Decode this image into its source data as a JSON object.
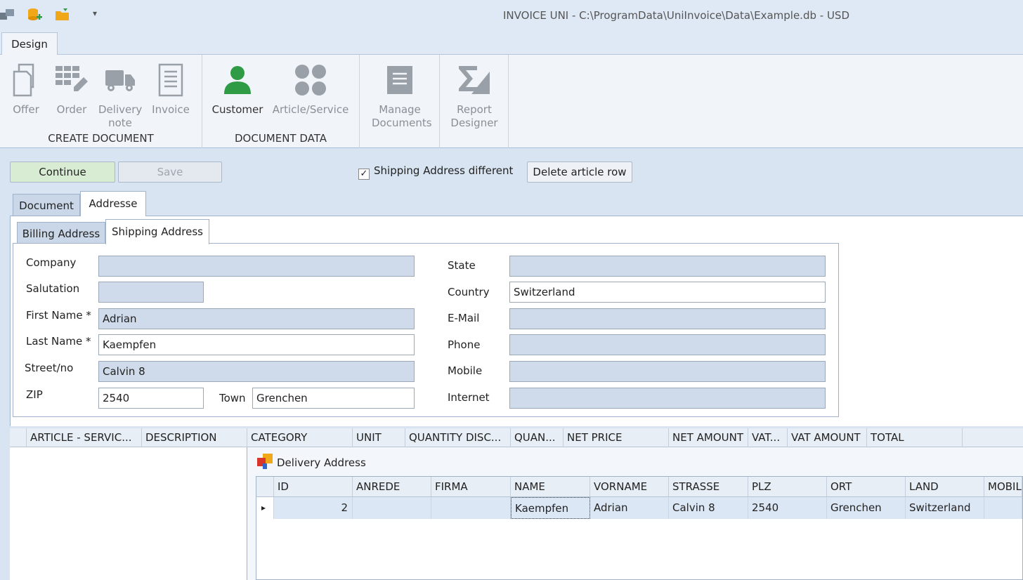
{
  "window": {
    "title": "INVOICE UNI - C:\\ProgramData\\UniInvoice\\Data\\Example.db - USD"
  },
  "quick_access": {
    "icons": [
      "app-icon",
      "database-add-icon",
      "folder-open-icon",
      "customize-dropdown-icon"
    ],
    "dropdown_glyph": "▾"
  },
  "ribbon": {
    "tab": "Design",
    "groups": {
      "create_document": {
        "label": "CREATE DOCUMENT",
        "offer": "Offer",
        "order": "Order",
        "delivery_note": "Delivery note",
        "invoice": "Invoice"
      },
      "document_data": {
        "label": "DOCUMENT DATA",
        "customer": "Customer",
        "article_service": "Article/Service"
      },
      "manage": {
        "label": "Manage Documents"
      },
      "report": {
        "label": "Report Designer"
      }
    },
    "accent_green": "#2f9b45"
  },
  "toolbar": {
    "continue": "Continue",
    "save": "Save",
    "shipping_different": "Shipping Address different",
    "shipping_checked": "✓",
    "delete_row": "Delete article row"
  },
  "tabs": {
    "document": "Document",
    "addresse": "Addresse",
    "billing": "Billing Address",
    "shipping": "Shipping Address"
  },
  "form": {
    "company": {
      "label": "Company",
      "value": ""
    },
    "salutation": {
      "label": "Salutation",
      "value": ""
    },
    "first_name": {
      "label": "First Name *",
      "value": "Adrian"
    },
    "last_name": {
      "label": "Last Name *",
      "value": "Kaempfen"
    },
    "street": {
      "label": "Street/no",
      "value": "Calvin 8"
    },
    "zip": {
      "label": "ZIP",
      "value": "2540"
    },
    "town": {
      "label": "Town",
      "value": "Grenchen"
    },
    "state": {
      "label": "State",
      "value": ""
    },
    "country": {
      "label": "Country",
      "value": "Switzerland"
    },
    "email": {
      "label": "E-Mail",
      "value": ""
    },
    "phone": {
      "label": "Phone",
      "value": ""
    },
    "mobile": {
      "label": "Mobile",
      "value": ""
    },
    "internet": {
      "label": "Internet",
      "value": ""
    }
  },
  "article_grid": {
    "columns": [
      "ARTICLE - SERVIC...",
      "DESCRIPTION",
      "CATEGORY",
      "UNIT",
      "QUANTITY DISC...",
      "QUAN...",
      "NET PRICE",
      "NET AMOUNT",
      "VAT...",
      "VAT AMOUNT",
      "TOTAL"
    ]
  },
  "delivery": {
    "title": "Delivery Address",
    "columns": [
      "ID",
      "ANREDE",
      "FIRMA",
      "NAME",
      "VORNAME",
      "STRASSE",
      "PLZ",
      "ORT",
      "LAND",
      "MOBIL"
    ],
    "row": [
      "2",
      "",
      "",
      "Kaempfen",
      "Adrian",
      "Calvin 8",
      "2540",
      "Grenchen",
      "Switzerland",
      ""
    ],
    "row_marker": "▸"
  }
}
